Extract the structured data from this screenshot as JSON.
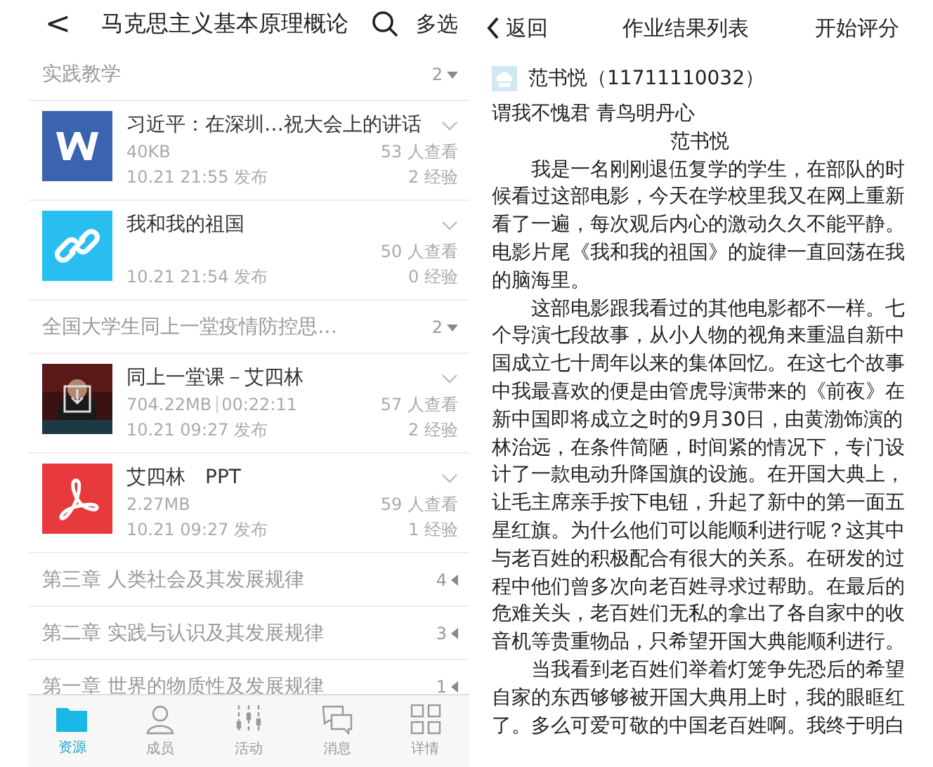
{
  "left": {
    "header": {
      "back": "<",
      "title": "马克思主义基本原理概论",
      "action": "多选"
    },
    "sections": [
      {
        "title": "实践教学",
        "count": "2",
        "expanded": true,
        "items": [
          {
            "kind": "word",
            "title": "习近平：在深圳…祝大会上的讲话",
            "size": "40KB",
            "time": "10.21 21:55 发布",
            "views": "53 人查看",
            "exp": "2 经验"
          },
          {
            "kind": "link",
            "title": "我和我的祖国",
            "time": "10.21 21:54 发布",
            "views": "50 人查看",
            "exp": "0 经验"
          }
        ]
      },
      {
        "title": "全国大学生同上一堂疫情防控思…",
        "count": "2",
        "expanded": true,
        "items": [
          {
            "kind": "video",
            "title": "同上一堂课－艾四林",
            "size": "704.22MB",
            "duration": "00:22:11",
            "time": "10.21 09:27 发布",
            "views": "57 人查看",
            "exp": "2 经验"
          },
          {
            "kind": "pdf",
            "title": "艾四林　PPT",
            "size": "2.27MB",
            "time": "10.21 09:27 发布",
            "views": "59 人查看",
            "exp": "1 经验"
          }
        ]
      },
      {
        "title": "第三章 人类社会及其发展规律",
        "count": "4",
        "expanded": false
      },
      {
        "title": "第二章 实践与认识及其发展规律",
        "count": "3",
        "expanded": false
      },
      {
        "title": "第一章 世界的物质性及发展规律",
        "count": "1",
        "expanded": false
      }
    ],
    "tabs": [
      {
        "kind": "folder",
        "label": "资源",
        "selected": true
      },
      {
        "kind": "person",
        "label": "成员",
        "selected": false
      },
      {
        "kind": "sliders",
        "label": "活动",
        "selected": false
      },
      {
        "kind": "chat",
        "label": "消息",
        "selected": false
      },
      {
        "kind": "grid",
        "label": "详情",
        "selected": false
      }
    ]
  },
  "right": {
    "header": {
      "back": "返回",
      "title": "作业结果列表",
      "action": "开始评分"
    },
    "student": "范书悦（11711110032）",
    "essay_title": "谓我不愧君 青鸟明丹心",
    "author": "范书悦",
    "paragraphs": [
      "我是一名刚刚退伍复学的学生，在部队的时候看过这部电影，今天在学校里我又在网上重新看了一遍，每次观后内心的激动久久不能平静。电影片尾《我和我的祖国》的旋律一直回荡在我的脑海里。",
      "这部电影跟我看过的其他电影都不一样。七个导演七段故事，从小人物的视角来重温自新中国成立七十周年以来的集体回忆。在这七个故事中我最喜欢的便是由管虎导演带来的《前夜》在新中国即将成立之时的9月30日，由黄渤饰演的林治远，在条件简陋，时间紧的情况下，专门设计了一款电动升降国旗的设施。在开国大典上，让毛主席亲手按下电钮，升起了新中的第一面五星红旗。为什么他们可以能顺利进行呢？这其中与老百姓的积极配合有很大的关系。在研发的过程中他们曾多次向老百姓寻求过帮助。在最后的危难关头，老百姓们无私的拿出了各自家中的收音机等贵重物品，只希望开国大典能顺利进行。",
      "当我看到老百姓们举着灯笼争先恐后的希望自家的东西够够被开国大典用上时，我的眼眶红了。多么可爱可敬的中国老百姓啊。我终于明白"
    ]
  }
}
